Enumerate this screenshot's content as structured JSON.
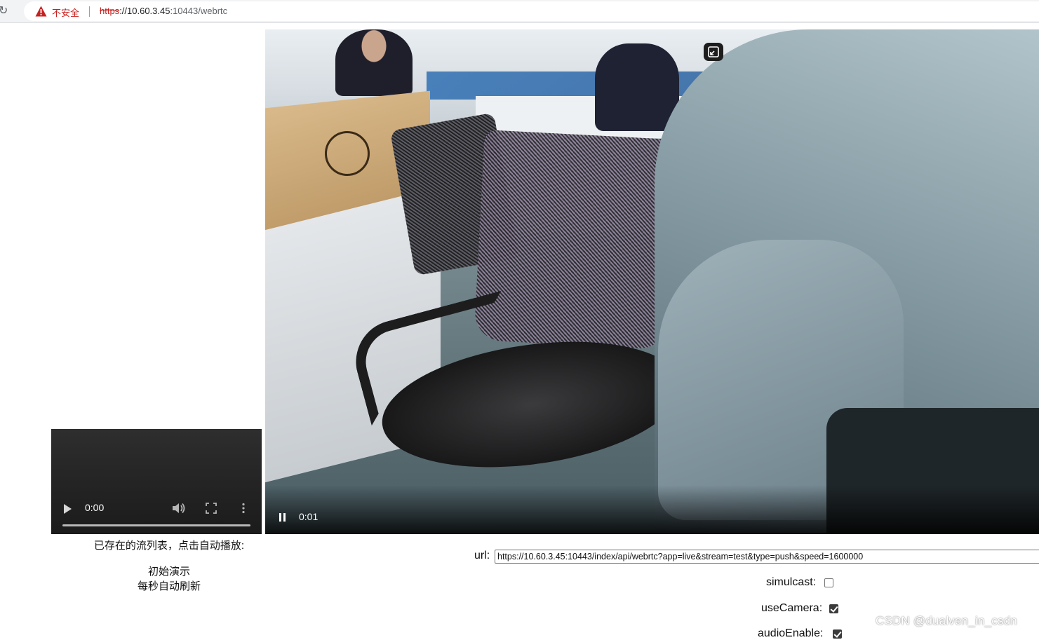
{
  "browser": {
    "security_label": "不安全",
    "url_scheme": "https",
    "url_host": "://10.60.3.45",
    "url_rest": ":10443/webrtc"
  },
  "player_small": {
    "time": "0:00"
  },
  "player_big": {
    "time": "0:01",
    "state": "playing"
  },
  "sidebar": {
    "list_label": "已存在的流列表，点击自动播放:",
    "streams": [
      "初始演示"
    ],
    "refresh_note": "每秒自动刷新"
  },
  "form": {
    "url_label": "url:",
    "url_value": "https://10.60.3.45:10443/index/api/webrtc?app=live&stream=test&type=push&speed=1600000",
    "options": [
      {
        "label": "simulcast:",
        "checked": false
      },
      {
        "label": "useCamera:",
        "checked": true
      },
      {
        "label": "audioEnable:",
        "checked": true
      }
    ]
  },
  "watermark": "CSDN @dualven_in_csdn",
  "colors": {
    "insecure_red": "#c5221f",
    "video_bg": "#1b1b1b"
  }
}
